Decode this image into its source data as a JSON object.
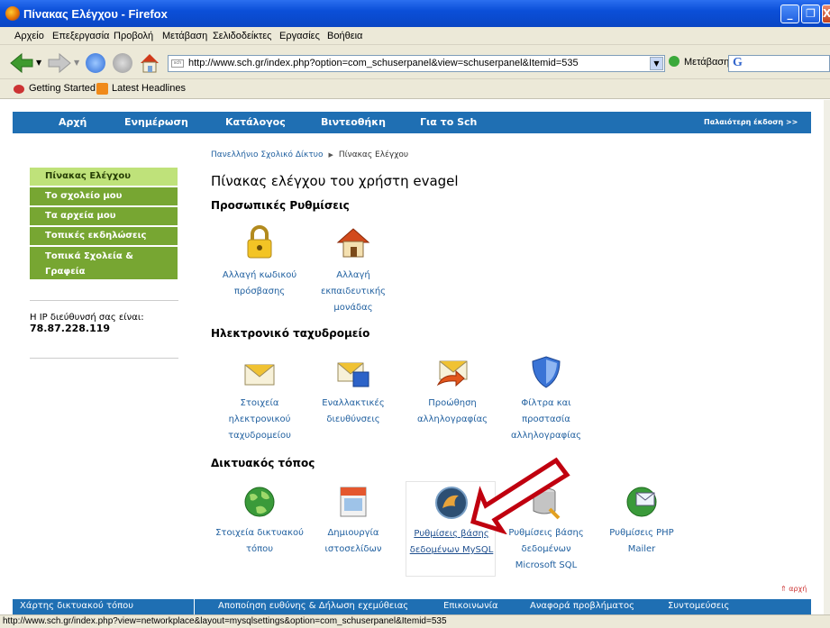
{
  "window": {
    "title": "Πίνακας Ελέγχου - Firefox"
  },
  "menu": [
    "Αρχείο",
    "Επεξεργασία",
    "Προβολή",
    "Μετάβαση",
    "Σελιδοδείκτες",
    "Εργασίες",
    "Βοήθεια"
  ],
  "toolbar": {
    "url": "http://www.sch.gr/index.php?option=com_schuserpanel&view=schuserpanel&Itemid=535",
    "go_label": "Μετάβαση",
    "search_logo": "G"
  },
  "bookmarks": [
    "Getting Started",
    "Latest Headlines"
  ],
  "topnav": {
    "items": [
      "Αρχή",
      "Ενημέρωση",
      "Κατάλογος",
      "Βιντεοθήκη",
      "Για το Sch"
    ],
    "old_version": "Παλαιότερη έκδοση >>"
  },
  "sidebar": {
    "items": [
      "Πίνακας Ελέγχου",
      "Το σχολείο μου",
      "Τα αρχεία μου",
      "Τοπικές εκδηλώσεις",
      "Τοπικά Σχολεία &",
      "Γραφεία"
    ],
    "ip_label": "Η IP διεύθυνσή σας είναι:",
    "ip_value": "78.87.228.119"
  },
  "breadcrumb": {
    "home": "Πανελλήνιο Σχολικό Δίκτυο",
    "current": "Πίνακας Ελέγχου"
  },
  "page_title": "Πίνακας ελέγχου του χρήστη evagel",
  "sections": {
    "personal": {
      "title": "Προσωπικές Ρυθμίσεις",
      "items": [
        {
          "icon": "lock-icon",
          "lines": [
            "Αλλαγή κωδικού",
            "πρόσβασης"
          ]
        },
        {
          "icon": "house-icon",
          "lines": [
            "Αλλαγή",
            "εκπαιδευτικής",
            "μονάδας"
          ]
        }
      ]
    },
    "email": {
      "title": "Ηλεκτρονικό ταχυδρομείο",
      "items": [
        {
          "icon": "envelope-icon",
          "lines": [
            "Στοιχεία",
            "ηλεκτρονικού",
            "ταχυδρομείου"
          ]
        },
        {
          "icon": "envelope-alt-icon",
          "lines": [
            "Εναλλακτικές",
            "διευθύνσεις"
          ]
        },
        {
          "icon": "forward-mail-icon",
          "lines": [
            "Προώθηση",
            "αλληλογραφίας"
          ]
        },
        {
          "icon": "shield-icon",
          "lines": [
            "Φίλτρα και",
            "προστασία",
            "αλληλογραφίας"
          ]
        }
      ]
    },
    "website": {
      "title": "Δικτυακός τόπος",
      "items": [
        {
          "icon": "globe-icon",
          "lines": [
            "Στοιχεία δικτυακού",
            "τόπου"
          ]
        },
        {
          "icon": "html-page-icon",
          "lines": [
            "Δημιουργία",
            "ιστοσελίδων"
          ]
        },
        {
          "icon": "mysql-icon",
          "lines": [
            "Ρυθμίσεις βάσης",
            "δεδομένων MySQL"
          ]
        },
        {
          "icon": "database-icon",
          "lines": [
            "Ρυθμίσεις βάσης",
            "δεδομένων",
            "Microsoft SQL"
          ]
        },
        {
          "icon": "mail-globe-icon",
          "lines": [
            "Ρυθμίσεις PHP",
            "Mailer"
          ]
        }
      ]
    }
  },
  "top_link": "⇑ αρχή",
  "footer": [
    "Χάρτης δικτυακού τόπου",
    "Αποποίηση ευθύνης & Δήλωση εχεμύθειας",
    "Επικοινωνία",
    "Αναφορά προβλήματος",
    "Συντομεύσεις"
  ],
  "status_url": "http://www.sch.gr/index.php?view=networkplace&layout=mysqlsettings&option=com_schuserpanel&Itemid=535",
  "colors": {
    "nav_blue": "#1f6fb3",
    "menu_green": "#77a632",
    "active_green": "#bfe27a",
    "arrow_red": "#c0000f"
  }
}
